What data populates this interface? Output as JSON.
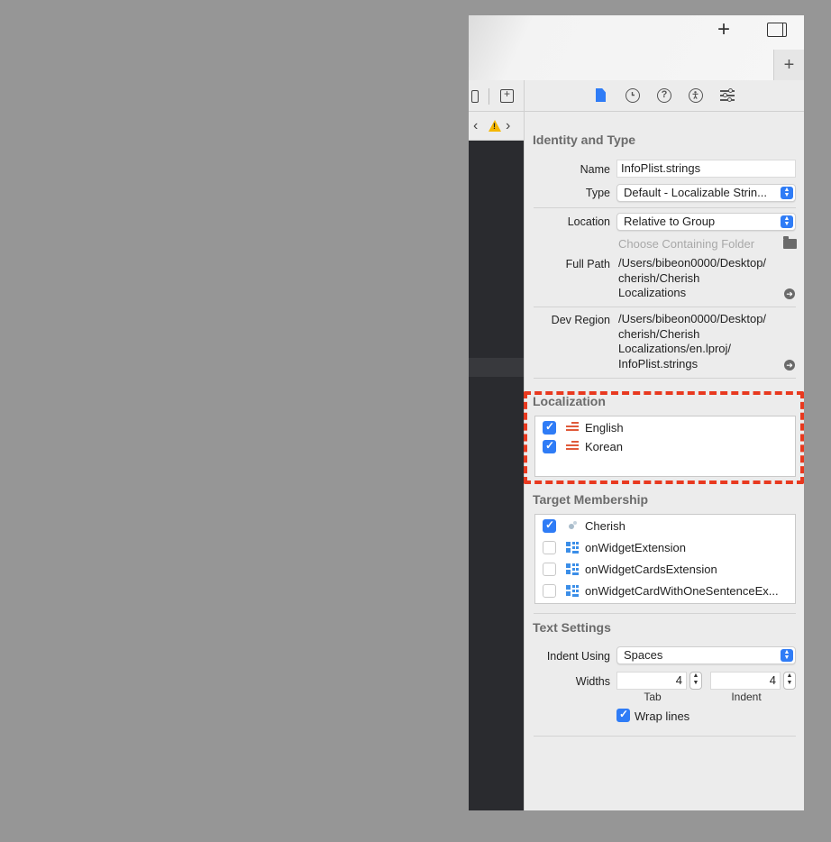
{
  "toolbar": {
    "add_symbol": "+",
    "tab_add_symbol": "+"
  },
  "editor": {
    "nav_back": "‹",
    "nav_forward": "›",
    "warning_symbol": "!"
  },
  "inspector": {
    "tabs": [
      "file-inspector",
      "history-inspector",
      "quick-help",
      "accessibility-inspector",
      "attributes-inspector"
    ],
    "help_glyph": "?",
    "identity": {
      "title": "Identity and Type",
      "name_label": "Name",
      "name_value": "InfoPlist.strings",
      "type_label": "Type",
      "type_value": "Default - Localizable Strin...",
      "location_label": "Location",
      "location_value": "Relative to Group",
      "choose_folder": "Choose Containing Folder",
      "full_path_label": "Full Path",
      "full_path_lines": [
        "/Users/bibeon0000/Desktop/",
        "cherish/Cherish",
        "Localizations"
      ],
      "dev_region_label": "Dev Region",
      "dev_region_lines": [
        "/Users/bibeon0000/Desktop/",
        "cherish/Cherish",
        "Localizations/en.lproj/",
        "InfoPlist.strings"
      ]
    },
    "localization": {
      "title": "Localization",
      "items": [
        {
          "label": "English",
          "checked": true
        },
        {
          "label": "Korean",
          "checked": true
        }
      ]
    },
    "target_membership": {
      "title": "Target Membership",
      "items": [
        {
          "label": "Cherish",
          "checked": true,
          "icon": "app-icon"
        },
        {
          "label": "onWidgetExtension",
          "checked": false,
          "icon": "widget-extension-icon"
        },
        {
          "label": "onWidgetCardsExtension",
          "checked": false,
          "icon": "widget-extension-icon"
        },
        {
          "label": "onWidgetCardWithOneSentenceEx...",
          "checked": false,
          "icon": "widget-extension-icon"
        }
      ]
    },
    "text_settings": {
      "title": "Text Settings",
      "indent_label": "Indent Using",
      "indent_value": "Spaces",
      "widths_label": "Widths",
      "tab_value": "4",
      "indent_width_value": "4",
      "tab_caption": "Tab",
      "indent_caption": "Indent",
      "wrap_lines_label": "Wrap lines",
      "wrap_lines_checked": true
    }
  },
  "colors": {
    "accent": "#2f7cf6",
    "highlight": "#e8391f",
    "background": "#969696"
  }
}
